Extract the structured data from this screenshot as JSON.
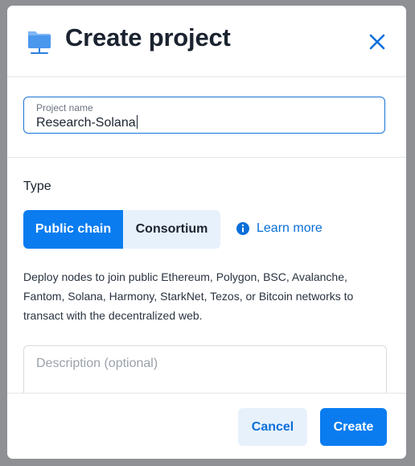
{
  "modal": {
    "title": "Create project",
    "header_icon": "folder-network-icon",
    "close_icon": "close-icon"
  },
  "project_name": {
    "label": "Project name",
    "value": "Research-Solana"
  },
  "type": {
    "label": "Type",
    "options": [
      "Public chain",
      "Consortium"
    ],
    "selected": "Public chain",
    "learn_more": "Learn more",
    "description": "Deploy nodes to join public Ethereum, Polygon, BSC, Avalanche, Fantom, Solana, Harmony, StarkNet, Tezos, or Bitcoin networks to transact with the decentralized web."
  },
  "description_field": {
    "placeholder": "Description (optional)"
  },
  "footer": {
    "cancel_label": "Cancel",
    "create_label": "Create"
  },
  "colors": {
    "accent": "#0a7cf0",
    "accent_light": "#e7f1fc",
    "text": "#1b2330"
  }
}
